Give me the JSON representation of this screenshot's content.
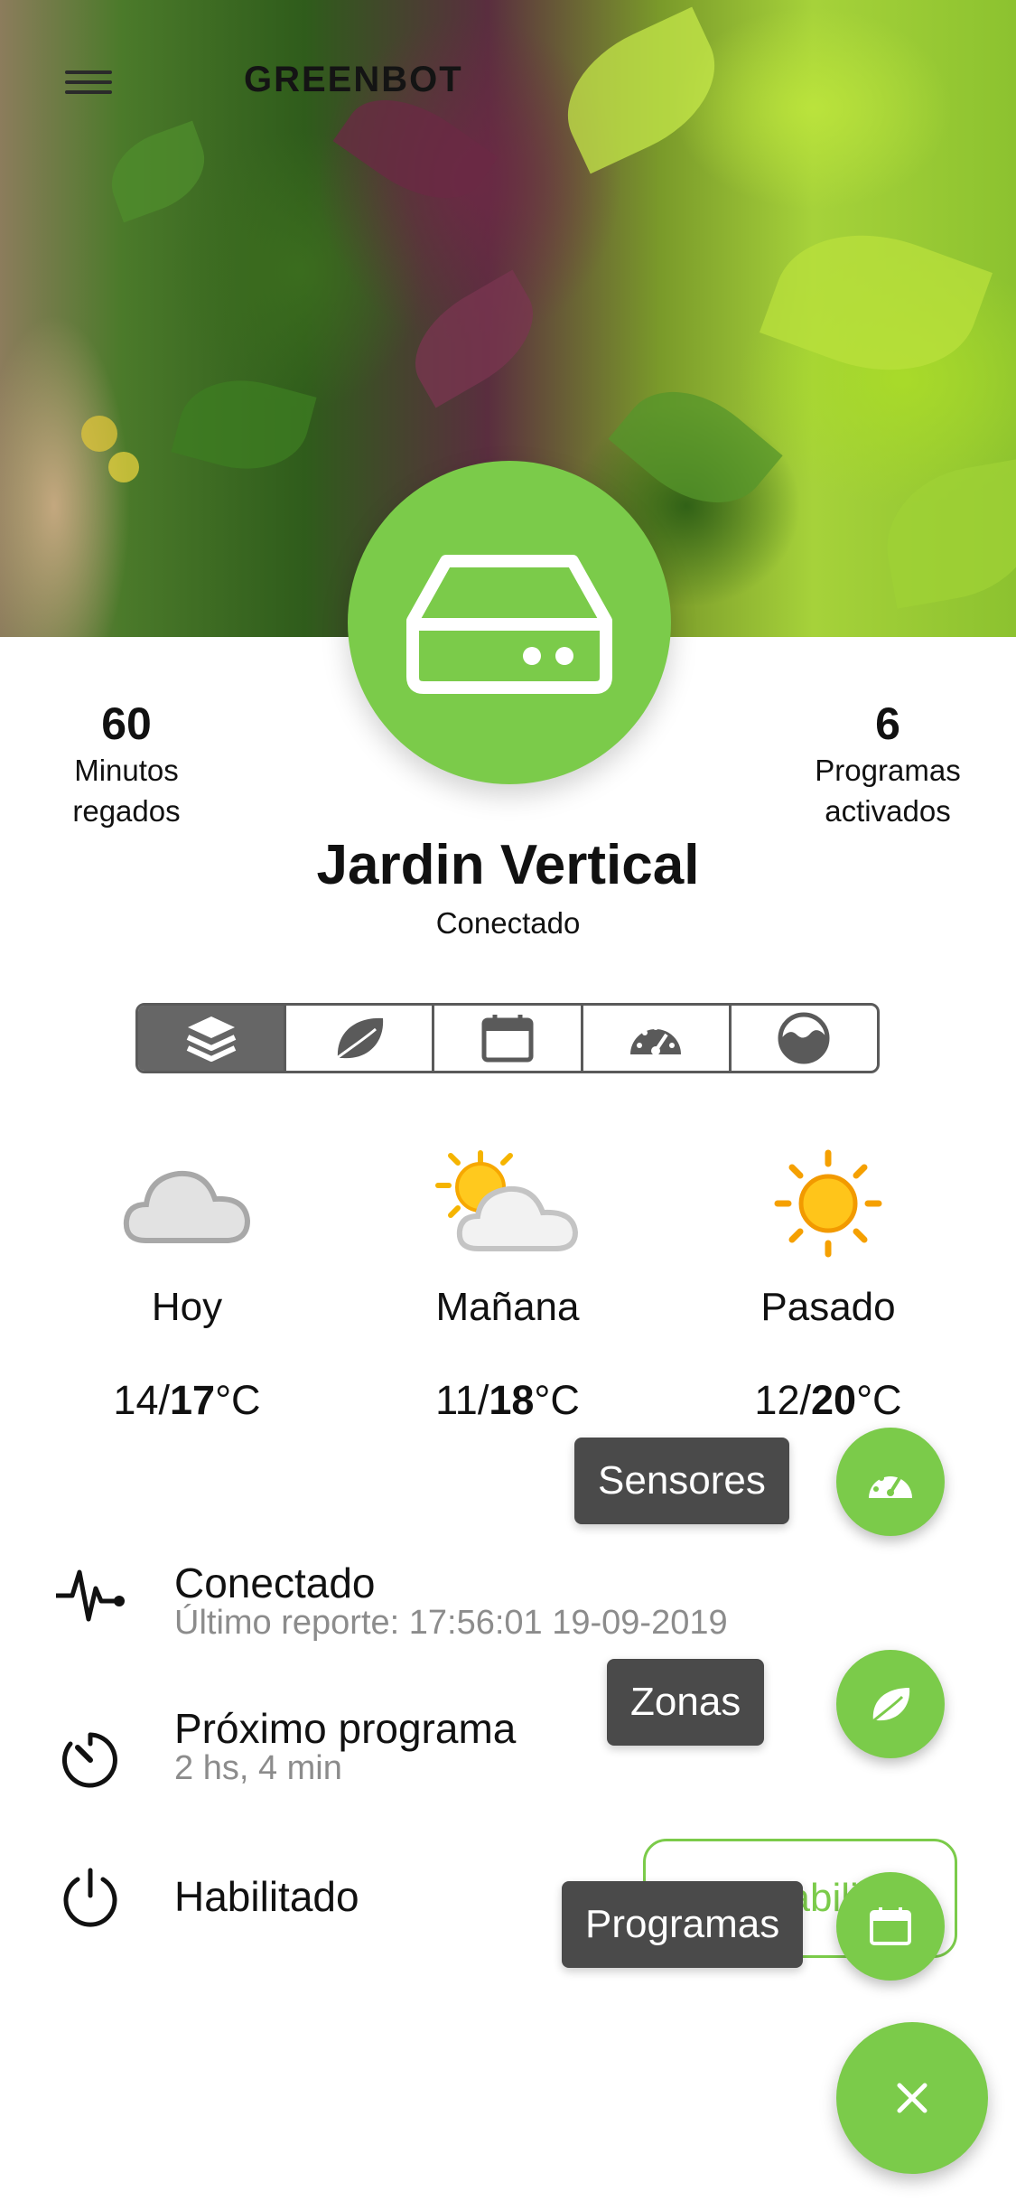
{
  "header": {
    "brand": "GREENBOT",
    "menu_icon": "hamburger-icon"
  },
  "device": {
    "icon": "server-icon",
    "name": "Jardin Vertical",
    "status": "Conectado"
  },
  "stats": {
    "left": {
      "value": "60",
      "label_line1": "Minutos",
      "label_line2": "regados"
    },
    "right": {
      "value": "6",
      "label_line1": "Programas",
      "label_line2": "activados"
    }
  },
  "tabs": [
    {
      "icon": "layers-icon",
      "active": true
    },
    {
      "icon": "leaf-icon",
      "active": false
    },
    {
      "icon": "calendar-icon",
      "active": false
    },
    {
      "icon": "gauge-icon",
      "active": false
    },
    {
      "icon": "moisture-icon",
      "active": false
    }
  ],
  "weather": [
    {
      "icon": "cloud-icon",
      "day": "Hoy",
      "min": "14",
      "max": "17",
      "unit": "°C"
    },
    {
      "icon": "partly-sunny-icon",
      "day": "Mañana",
      "min": "11",
      "max": "18",
      "unit": "°C"
    },
    {
      "icon": "sun-icon",
      "day": "Pasado",
      "min": "12",
      "max": "20",
      "unit": "°C"
    }
  ],
  "info": {
    "connection": {
      "icon": "pulse-icon",
      "title": "Conectado",
      "subtitle": "Último reporte: 17:56:01 19-09-2019"
    },
    "next_program": {
      "icon": "timer-icon",
      "title": "Próximo programa",
      "subtitle": "2 hs, 4 min"
    },
    "enabled": {
      "icon": "power-icon",
      "title": "Habilitado",
      "button": "Deshabilitar"
    }
  },
  "speed_dial": {
    "sensors_label": "Sensores",
    "zones_label": "Zonas",
    "programs_label": "Programas",
    "close_icon": "close-icon"
  },
  "colors": {
    "accent": "#7bcb4a",
    "tab_active": "#666666",
    "label_bg": "#4a4a4a",
    "muted_text": "#8c8c8c"
  }
}
